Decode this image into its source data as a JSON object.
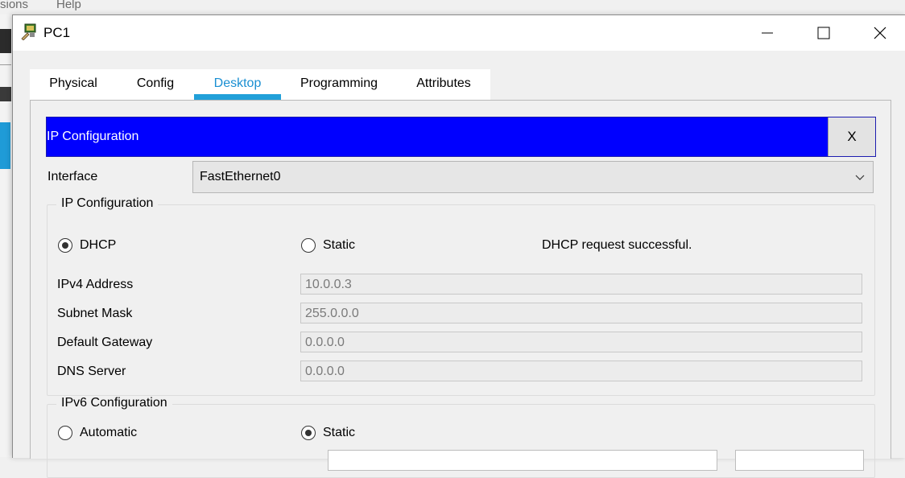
{
  "background_app": {
    "menu_items": [
      "sions",
      "Help"
    ]
  },
  "window": {
    "title": "PC1",
    "controls": {
      "minimize": "minimize",
      "maximize": "maximize",
      "close": "close"
    }
  },
  "tabs": [
    {
      "label": "Physical",
      "active": false
    },
    {
      "label": "Config",
      "active": false
    },
    {
      "label": "Desktop",
      "active": true
    },
    {
      "label": "Programming",
      "active": false
    },
    {
      "label": "Attributes",
      "active": false
    }
  ],
  "ip_config": {
    "header_title": "IP Configuration",
    "close_label": "X",
    "interface_label": "Interface",
    "interface_value": "FastEthernet0",
    "ipv4_group": {
      "legend": "IP Configuration",
      "dhcp_label": "DHCP",
      "static_label": "Static",
      "mode": "DHCP",
      "status_message": "DHCP request successful.",
      "fields": [
        {
          "label": "IPv4 Address",
          "value": "10.0.0.3"
        },
        {
          "label": "Subnet Mask",
          "value": "255.0.0.0"
        },
        {
          "label": "Default Gateway",
          "value": "0.0.0.0"
        },
        {
          "label": "DNS Server",
          "value": "0.0.0.0"
        }
      ]
    },
    "ipv6_group": {
      "legend": "IPv6 Configuration",
      "automatic_label": "Automatic",
      "static_label": "Static",
      "mode": "Static"
    }
  },
  "colors": {
    "header_blue": "#0000ff",
    "tab_accent": "#21a0d9",
    "active_tab_text": "#1a8fd2"
  }
}
